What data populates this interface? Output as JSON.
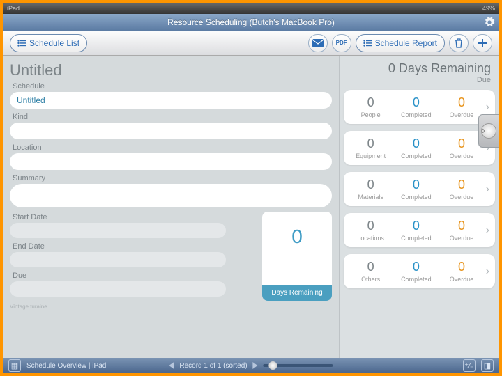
{
  "status": {
    "carrier": "iPad",
    "battery": "49%"
  },
  "title": "Resource Scheduling (Butch's MacBook Pro)",
  "toolbar": {
    "schedule_list": "Schedule List",
    "schedule_report": "Schedule Report",
    "pdf": "PDF"
  },
  "left": {
    "heading": "Untitled",
    "schedule_lbl": "Schedule",
    "schedule_val": "Untitled",
    "kind_lbl": "Kind",
    "location_lbl": "Location",
    "summary_lbl": "Summary",
    "start_lbl": "Start Date",
    "end_lbl": "End Date",
    "due_lbl": "Due",
    "days_num": "0",
    "days_lbl": "Days Remaining"
  },
  "right": {
    "remaining": "0 Days Remaining",
    "due": "Due",
    "completed": "Completed",
    "overdue": "Overdue",
    "cards": [
      {
        "label": "People",
        "n": "0",
        "c": "0",
        "o": "0"
      },
      {
        "label": "Equipment",
        "n": "0",
        "c": "0",
        "o": "0"
      },
      {
        "label": "Materials",
        "n": "0",
        "c": "0",
        "o": "0"
      },
      {
        "label": "Locations",
        "n": "0",
        "c": "0",
        "o": "0"
      },
      {
        "label": "Others",
        "n": "0",
        "c": "0",
        "o": "0"
      }
    ]
  },
  "footer": {
    "layout": "Schedule Overview | iPad",
    "record": "Record 1 of 1 (sorted)"
  }
}
